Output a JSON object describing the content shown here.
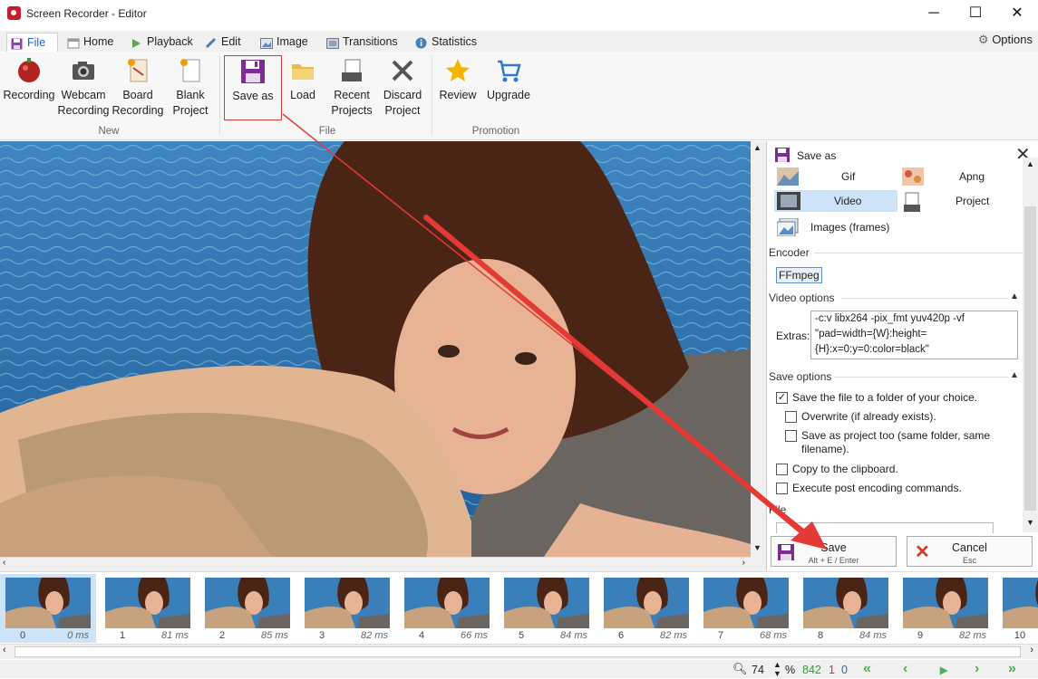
{
  "window": {
    "title": "Screen Recorder - Editor",
    "minimize": "─",
    "maximize": "☐",
    "close": "✕"
  },
  "tabs": [
    {
      "label": "File",
      "active": true
    },
    {
      "label": "Home"
    },
    {
      "label": "Playback"
    },
    {
      "label": "Edit"
    },
    {
      "label": "Image"
    },
    {
      "label": "Transitions"
    },
    {
      "label": "Statistics"
    }
  ],
  "options_label": "Options",
  "ribbon": {
    "new": {
      "group": "New",
      "recording": "Recording",
      "webcam": [
        "Webcam",
        "Recording"
      ],
      "board": [
        "Board",
        "Recording"
      ],
      "blank": [
        "Blank",
        "Project"
      ]
    },
    "file": {
      "group": "File",
      "save_as": "Save as",
      "load": "Load",
      "recent": [
        "Recent",
        "Projects"
      ],
      "discard": [
        "Discard",
        "Project"
      ]
    },
    "promotion": {
      "group": "Promotion",
      "review": "Review",
      "upgrade": "Upgrade"
    }
  },
  "panel": {
    "title": "Save as",
    "formats": {
      "gif": "Gif",
      "apng": "Apng",
      "video": "Video",
      "project": "Project",
      "images": "Images (frames)"
    },
    "selected_format": "Video",
    "encoder_label": "Encoder",
    "encoder_value": "FFmpeg",
    "video_options_label": "Video options",
    "extras_label": "Extras:",
    "extras_value": "-c:v libx264 -pix_fmt yuv420p -vf \"pad=width={W}:height={H}:x=0:y=0:color=black\"",
    "save_options_label": "Save options",
    "options": {
      "save_folder": {
        "label": "Save the file to a folder of your choice.",
        "checked": true
      },
      "overwrite": {
        "label": "Overwrite (if already exists).",
        "checked": false
      },
      "save_project": {
        "label": "Save as project too (same folder, same filename).",
        "checked": false
      },
      "clipboard": {
        "label": "Copy to the clipboard.",
        "checked": false
      },
      "post_encoding": {
        "label": "Execute post encoding commands.",
        "checked": false
      }
    },
    "file_label": "File",
    "save_button": {
      "label": "Save",
      "shortcut": "Alt + E / Enter"
    },
    "cancel_button": {
      "label": "Cancel",
      "shortcut": "Esc"
    }
  },
  "frames": [
    {
      "index": "0",
      "duration": "0 ms"
    },
    {
      "index": "1",
      "duration": "81 ms"
    },
    {
      "index": "2",
      "duration": "85 ms"
    },
    {
      "index": "3",
      "duration": "82 ms"
    },
    {
      "index": "4",
      "duration": "66 ms"
    },
    {
      "index": "5",
      "duration": "84 ms"
    },
    {
      "index": "6",
      "duration": "82 ms"
    },
    {
      "index": "7",
      "duration": "68 ms"
    },
    {
      "index": "8",
      "duration": "84 ms"
    },
    {
      "index": "9",
      "duration": "82 ms"
    },
    {
      "index": "10",
      "duration": ""
    }
  ],
  "status": {
    "zoom": "74",
    "zoom_unit": "%",
    "frame_count": "842",
    "selected_count": "1",
    "current_frame": "0"
  },
  "colors": {
    "accent": "#cde3f7",
    "annotation_arrow": "#e53935",
    "green": "#2e9e2e",
    "red": "#d32f2f",
    "blue": "#1e66c7"
  }
}
